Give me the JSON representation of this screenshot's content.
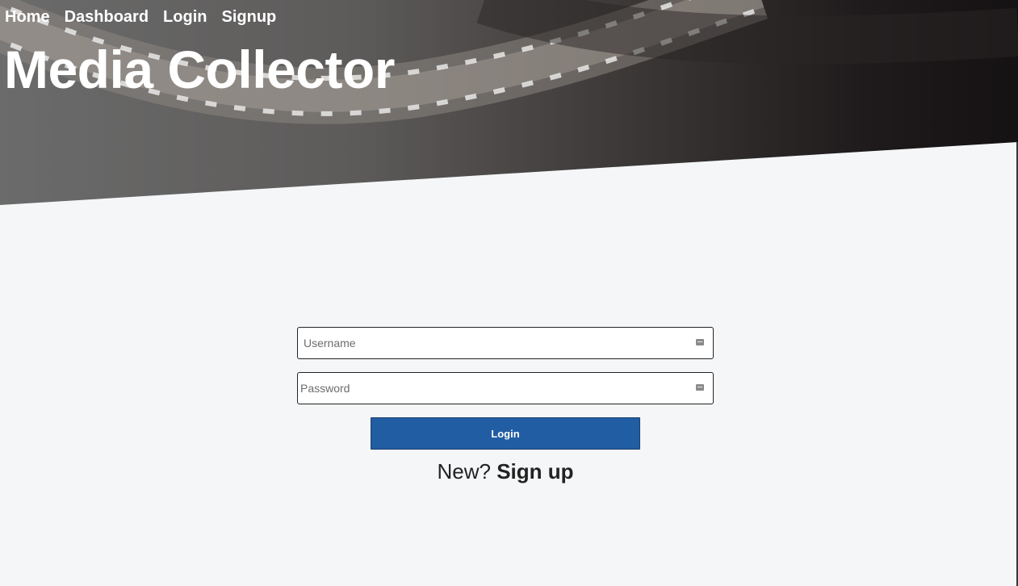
{
  "nav": {
    "items": [
      "Home",
      "Dashboard",
      "Login",
      "Signup"
    ]
  },
  "header": {
    "title": "Media Collector"
  },
  "login_form": {
    "username_placeholder": "Username",
    "password_placeholder": "Password",
    "submit_label": "Login",
    "signup_prompt": "New?",
    "signup_link": "Sign up"
  },
  "colors": {
    "primary_button": "#215da3",
    "page_background": "#f4f6f8",
    "text_light": "#ffffff"
  },
  "icons": {
    "field_icon": "key-icon"
  }
}
